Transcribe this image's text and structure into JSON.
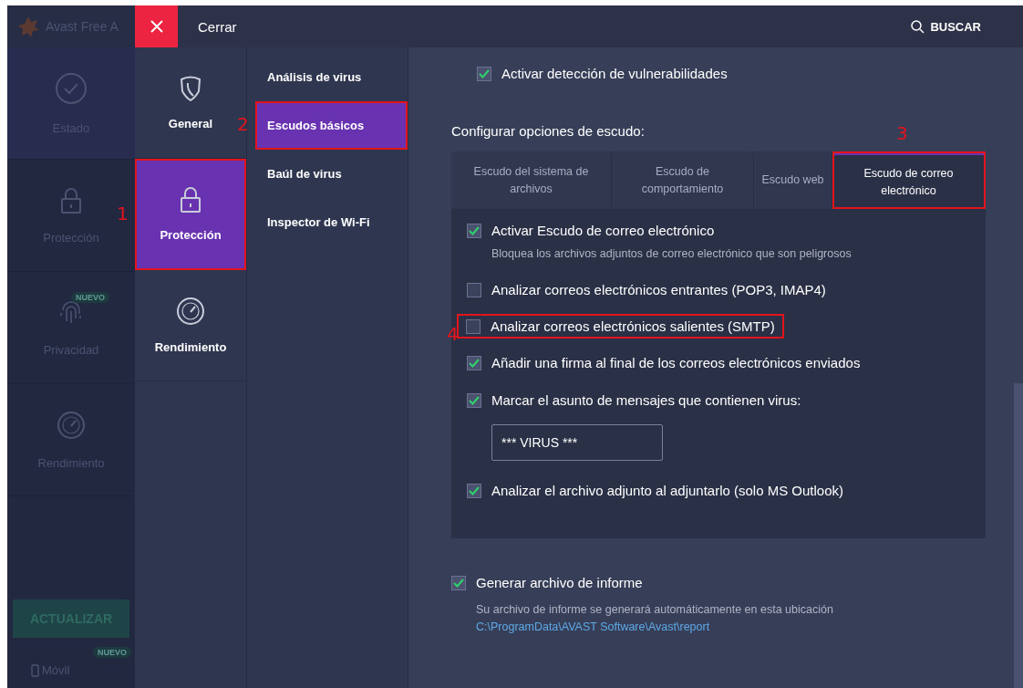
{
  "background_app": {
    "title": "Avast Free A",
    "nav": [
      {
        "label": "Estado",
        "selected": true
      },
      {
        "label": "Protección",
        "selected": false
      },
      {
        "label": "Privacidad",
        "selected": false,
        "badge": "NUEVO"
      },
      {
        "label": "Rendimiento",
        "selected": false
      }
    ],
    "update_button": "ACTUALIZAR",
    "mobile": {
      "badge": "NUEVO",
      "label": "Móvil"
    }
  },
  "header": {
    "close_label": "Cerrar",
    "search_label": "BUSCAR"
  },
  "categories": [
    {
      "label": "General",
      "selected": false
    },
    {
      "label": "Protección",
      "selected": true,
      "callout": "1"
    },
    {
      "label": "Rendimiento",
      "selected": false
    }
  ],
  "subnav": [
    {
      "label": "Análisis de virus",
      "selected": false
    },
    {
      "label": "Escudos básicos",
      "selected": true,
      "callout": "2"
    },
    {
      "label": "Baúl de virus",
      "selected": false
    },
    {
      "label": "Inspector de Wi-Fi",
      "selected": false
    }
  ],
  "content": {
    "top_option": {
      "label": "Activar detección de vulnerabilidades",
      "checked": true
    },
    "section_title": "Configurar opciones de escudo:",
    "tabs": [
      {
        "label": "Escudo del sistema de archivos",
        "selected": false
      },
      {
        "label": "Escudo de comportamiento",
        "selected": false
      },
      {
        "label": "Escudo web",
        "selected": false
      },
      {
        "label": "Escudo de correo electrónico",
        "selected": true,
        "callout": "3"
      }
    ],
    "options": [
      {
        "kind": "checkbox",
        "label": "Activar Escudo de correo electrónico",
        "checked": true,
        "description": "Bloquea los archivos adjuntos de correo electrónico que son peligrosos"
      },
      {
        "kind": "checkbox",
        "label": "Analizar correos electrónicos entrantes (POP3, IMAP4)",
        "checked": false
      },
      {
        "kind": "checkbox",
        "label": "Analizar correos electrónicos salientes (SMTP)",
        "checked": false,
        "callout": "4"
      },
      {
        "kind": "checkbox",
        "label": "Añadir una firma al final de los correos electrónicos enviados",
        "checked": true
      },
      {
        "kind": "checkbox",
        "label": "Marcar el asunto de mensajes que contienen virus:",
        "checked": true
      },
      {
        "kind": "text_field",
        "value": "*** VIRUS ***"
      },
      {
        "kind": "checkbox",
        "label": "Analizar el archivo adjunto al adjuntarlo (solo MS Outlook)",
        "checked": true
      }
    ],
    "report": {
      "label": "Generar archivo de informe",
      "checked": true,
      "description": "Su archivo de informe se generará automáticamente en esta ubicación",
      "path": "C:\\ProgramData\\AVAST Software\\Avast\\report"
    }
  }
}
